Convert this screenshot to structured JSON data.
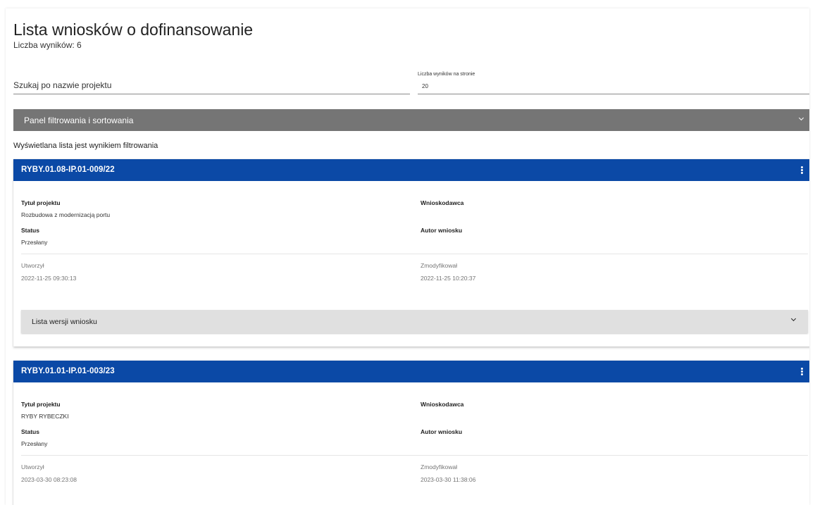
{
  "header": {
    "title": "Lista wniosków o dofinansowanie",
    "count": "Liczba wyników: 6"
  },
  "search": {
    "placeholder": "Szukaj po nazwie projektu",
    "value": ""
  },
  "per_page": {
    "label": "Liczba wyników na stronie",
    "value": "20"
  },
  "filter_panel": {
    "label": "Panel filtrowania i sortowania",
    "icon": "chevron-down-icon"
  },
  "filtered_note": "Wyświetlana lista jest wynikiem filtrowania",
  "colors": {
    "card_header": "#0b49a6",
    "filter_panel": "#757575",
    "versions_panel": "#e0e0e0"
  },
  "applications": [
    {
      "code": "RYBY.01.08-IP.01-009/22",
      "title_label": "Tytuł projektu",
      "title_value": "Rozbudowa z modernizacją portu",
      "applicant_label": "Wnioskodawca",
      "status_label": "Status",
      "status_value": "Przesłany",
      "author_label": "Autor wniosku",
      "created_label": "Utworzył",
      "created_value": "2022-11-25 09:30:13",
      "modified_label": "Zmodyfikował",
      "modified_value": "2022-11-25 10:20:37",
      "versions_label": "Lista wersji wniosku"
    },
    {
      "code": "RYBY.01.01-IP.01-003/23",
      "title_label": "Tytuł projektu",
      "title_value": "RYBY RYBECZKI",
      "applicant_label": "Wnioskodawca",
      "status_label": "Status",
      "status_value": "Przesłany",
      "author_label": "Autor wniosku",
      "created_label": "Utworzył",
      "created_value": "2023-03-30 08:23:08",
      "modified_label": "Zmodyfikował",
      "modified_value": "2023-03-30 11:38:06"
    }
  ]
}
